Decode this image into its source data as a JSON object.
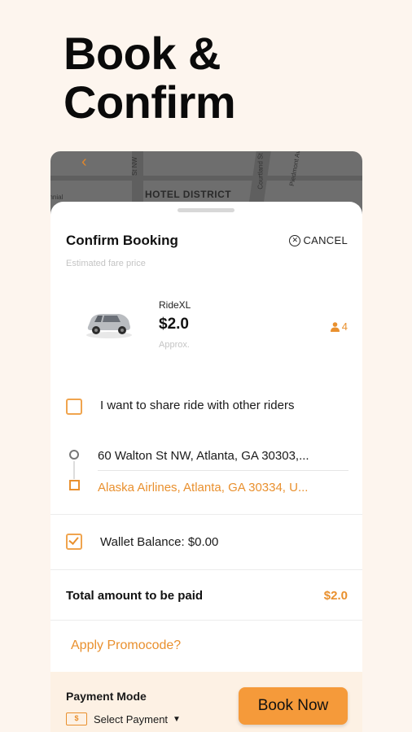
{
  "headline": {
    "line1": "Book &",
    "line2": "Confirm"
  },
  "map": {
    "district": "HOTEL DISTRICT",
    "streets": [
      "St NW",
      "Courtland St",
      "Piedmont Ave",
      "ennial"
    ]
  },
  "booking": {
    "title": "Confirm Booking",
    "cancel_label": "CANCEL",
    "subtitle": "Estimated fare price",
    "ride": {
      "name": "RideXL",
      "price": "$2.0",
      "approx": "Approx.",
      "seats": "4"
    },
    "share_label": "I want to share ride with other riders",
    "pickup": "60 Walton St NW, Atlanta, GA 30303,...",
    "dropoff": "Alaska Airlines, Atlanta, GA 30334, U...",
    "wallet_label": "Wallet Balance: $0.00",
    "total_label": "Total amount to be paid",
    "total_value": "$2.0",
    "promo_label": "Apply Promocode?"
  },
  "footer": {
    "payment_mode_label": "Payment Mode",
    "select_payment_label": "Select Payment",
    "book_now_label": "Book Now"
  },
  "colors": {
    "accent": "#e9902e",
    "button": "#f59a3a",
    "background": "#fdf5ee",
    "footer": "#fdf1e4"
  }
}
